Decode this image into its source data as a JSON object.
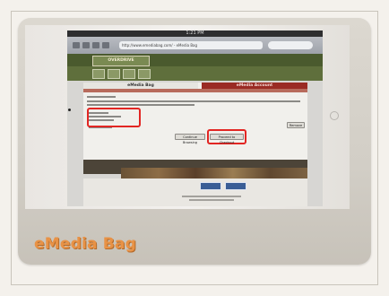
{
  "slide": {
    "caption": "eMedia Bag"
  },
  "photo": {
    "status_text": "1:21 PM",
    "url_text": "http://www.emediabag.com/ - eMedia Bag",
    "site_logo": "OVERDRIVE",
    "tab_left": "eMedia Bag",
    "tab_right": "eMedia Account",
    "button_proceed": "Proceed to Checkout",
    "button_continue": "Continue Browsing",
    "button_remove": "Remove"
  },
  "colors": {
    "caption": "#e89246",
    "highlight_box": "#e22623",
    "site_header": "#4a5a2e",
    "account_tab": "#9a2b24"
  }
}
